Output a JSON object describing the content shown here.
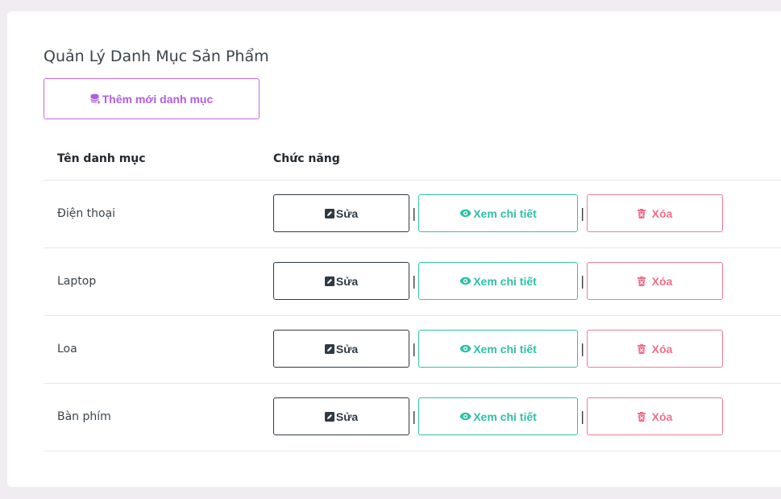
{
  "page": {
    "title": "Quản Lý Danh Mục Sản Phẩm",
    "add_button_label": "Thêm mới danh mục"
  },
  "table": {
    "columns": [
      "Tên danh mục",
      "Chức năng"
    ],
    "actions": {
      "edit_label": "Sửa",
      "view_label": "Xem chi tiết",
      "delete_label": "Xóa",
      "separator": "|"
    },
    "rows": [
      {
        "name": "Điện thoại"
      },
      {
        "name": "Laptop"
      },
      {
        "name": "Loa"
      },
      {
        "name": "Bàn phím"
      }
    ]
  },
  "icons": {
    "add": "database-plus-icon",
    "edit": "pencil-square-icon",
    "view": "eye-icon",
    "delete": "trash-icon"
  },
  "colors": {
    "background": "#f1ecf2",
    "card": "#ffffff",
    "add_accent": "#b35ddf",
    "edit": "#2f3a45",
    "view": "#2fbfa6",
    "delete": "#ee6f8a"
  }
}
